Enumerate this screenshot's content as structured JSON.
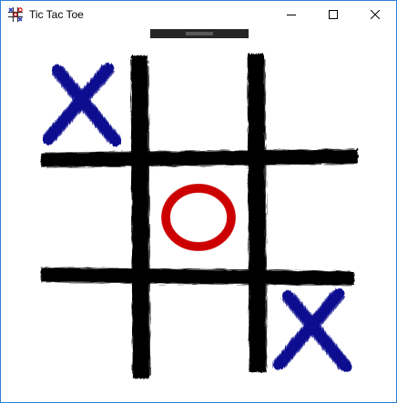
{
  "window": {
    "title": "Tic Tac Toe",
    "app_icon": "tic-tac-toe-app-icon",
    "controls": [
      "minimize-icon",
      "maximize-icon",
      "close-icon"
    ]
  },
  "board": {
    "cells": [
      "X",
      "",
      "",
      "",
      "O",
      "",
      "",
      "",
      "X"
    ],
    "colors": {
      "grid": "#000000",
      "x": "#0b1190",
      "o": "#cc0000",
      "window_border": "#2b7fd4",
      "handle": "#262626"
    }
  }
}
